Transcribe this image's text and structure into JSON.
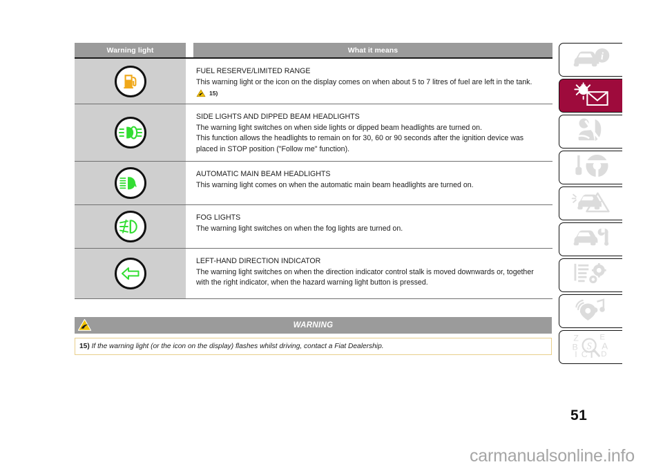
{
  "document": {
    "page_number": "51",
    "watermark": "carmanualsonline.info"
  },
  "table": {
    "header": {
      "col_warning_light": "Warning light",
      "col_what_it_means": "What it means"
    },
    "rows": [
      {
        "icon_name": "fuel-pump-warning-light-icon",
        "icon_label": "fuel reserve",
        "title": "FUEL RESERVE/LIMITED RANGE",
        "body": "This warning light or the icon on the display comes on when about 5 to 7 litres of fuel are left in the tank.",
        "body2": "",
        "body3": "",
        "footnote_ref": "15)"
      },
      {
        "icon_name": "side-lights-dipped-beam-warning-light-icon",
        "icon_label": "side lights and dipped beam",
        "title": "SIDE LIGHTS AND DIPPED BEAM HEADLIGHTS",
        "body": "The warning light switches on when side lights or dipped beam headlights are turned on.",
        "body2": "This function allows the headlights to remain on for 30, 60 or 90 seconds after the ignition device was",
        "body3": "placed in STOP position (\"Follow me\" function).",
        "footnote_ref": ""
      },
      {
        "icon_name": "automatic-main-beam-warning-light-icon",
        "icon_label": "automatic main beam",
        "title": "AUTOMATIC MAIN BEAM HEADLIGHTS",
        "body": "This warning light comes on when the automatic main beam headlights are turned on.",
        "body2": "",
        "body3": "",
        "footnote_ref": ""
      },
      {
        "icon_name": "fog-lights-warning-light-icon",
        "icon_label": "fog lights",
        "title": "FOG LIGHTS",
        "body": "The warning light switches on when the fog lights are turned on.",
        "body2": "",
        "body3": "",
        "footnote_ref": ""
      },
      {
        "icon_name": "left-direction-indicator-warning-light-icon",
        "icon_label": "left-hand direction indicator",
        "title": "LEFT-HAND DIRECTION INDICATOR",
        "body": "The warning light switches on when the direction indicator control stalk is moved downwards or, together",
        "body2": "with the right indicator, when the hazard warning light button is pressed.",
        "body3": "",
        "footnote_ref": ""
      }
    ]
  },
  "warning_box": {
    "bar_label": "WARNING",
    "bar_icon": "yellow-triangle-warning-icon",
    "note_number": "15)",
    "note_text": "If the warning light (or the icon on the display) flashes whilst driving, contact a Fiat Dealership."
  },
  "sidebar": {
    "accent_color": "#9e0b3c",
    "tabs": [
      {
        "icon": "car-info-icon",
        "label": "Dashboard and controls",
        "active": false
      },
      {
        "icon": "warning-lights-messages-icon",
        "label": "Warning lights and messages",
        "active": true
      },
      {
        "icon": "passenger-safety-icon",
        "label": "Safety",
        "active": false
      },
      {
        "icon": "key-steering-wheel-icon",
        "label": "Starting and driving",
        "active": false
      },
      {
        "icon": "emergency-hazard-icon",
        "label": "In an emergency",
        "active": false
      },
      {
        "icon": "car-maintenance-icon",
        "label": "Maintenance and care",
        "active": false
      },
      {
        "icon": "technical-specifications-icon",
        "label": "Technical specifications",
        "active": false
      },
      {
        "icon": "multimedia-icon",
        "label": "Multimedia",
        "active": false
      },
      {
        "icon": "alphabetical-index-icon",
        "label": "Alphabetical index",
        "active": false
      }
    ]
  },
  "colors": {
    "header_gray": "#9b9b9b",
    "row_gray": "#cfcfcf",
    "tell_green": "#33dd33",
    "fuel_orange": "#f0a81a",
    "warn_yellow": "#f2c200"
  }
}
